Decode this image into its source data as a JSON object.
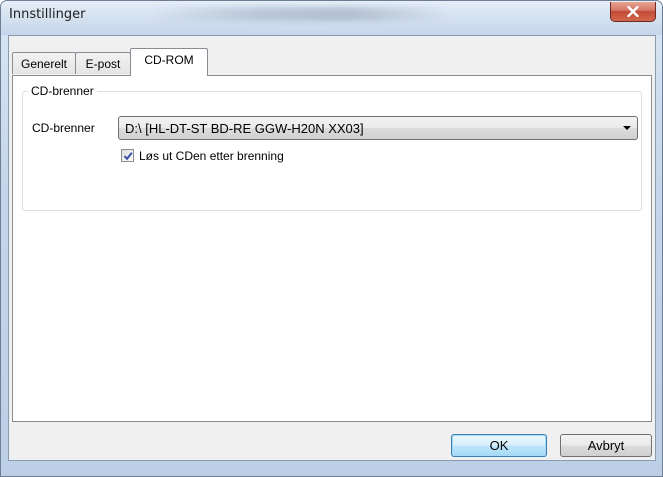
{
  "window": {
    "title": "Innstillinger"
  },
  "tabs": [
    {
      "label": "Generelt"
    },
    {
      "label": "E-post"
    },
    {
      "label": "CD-ROM"
    }
  ],
  "cdrom": {
    "group_title": "CD-brenner",
    "drive_label": "CD-brenner",
    "drive_value": "D:\\ [HL-DT-ST BD-RE  GGW-H20N  XX03]",
    "eject_label": "Løs ut CDen etter brenning",
    "eject_checked": true
  },
  "buttons": {
    "ok": "OK",
    "cancel": "Avbryt"
  },
  "icons": {
    "close": "close-icon",
    "dropdown": "chevron-down-icon",
    "check": "check-icon"
  },
  "colors": {
    "close_button": "#c24a35",
    "default_button_border": "#3c7fb1",
    "dialog_background": "#f0f0f0"
  }
}
